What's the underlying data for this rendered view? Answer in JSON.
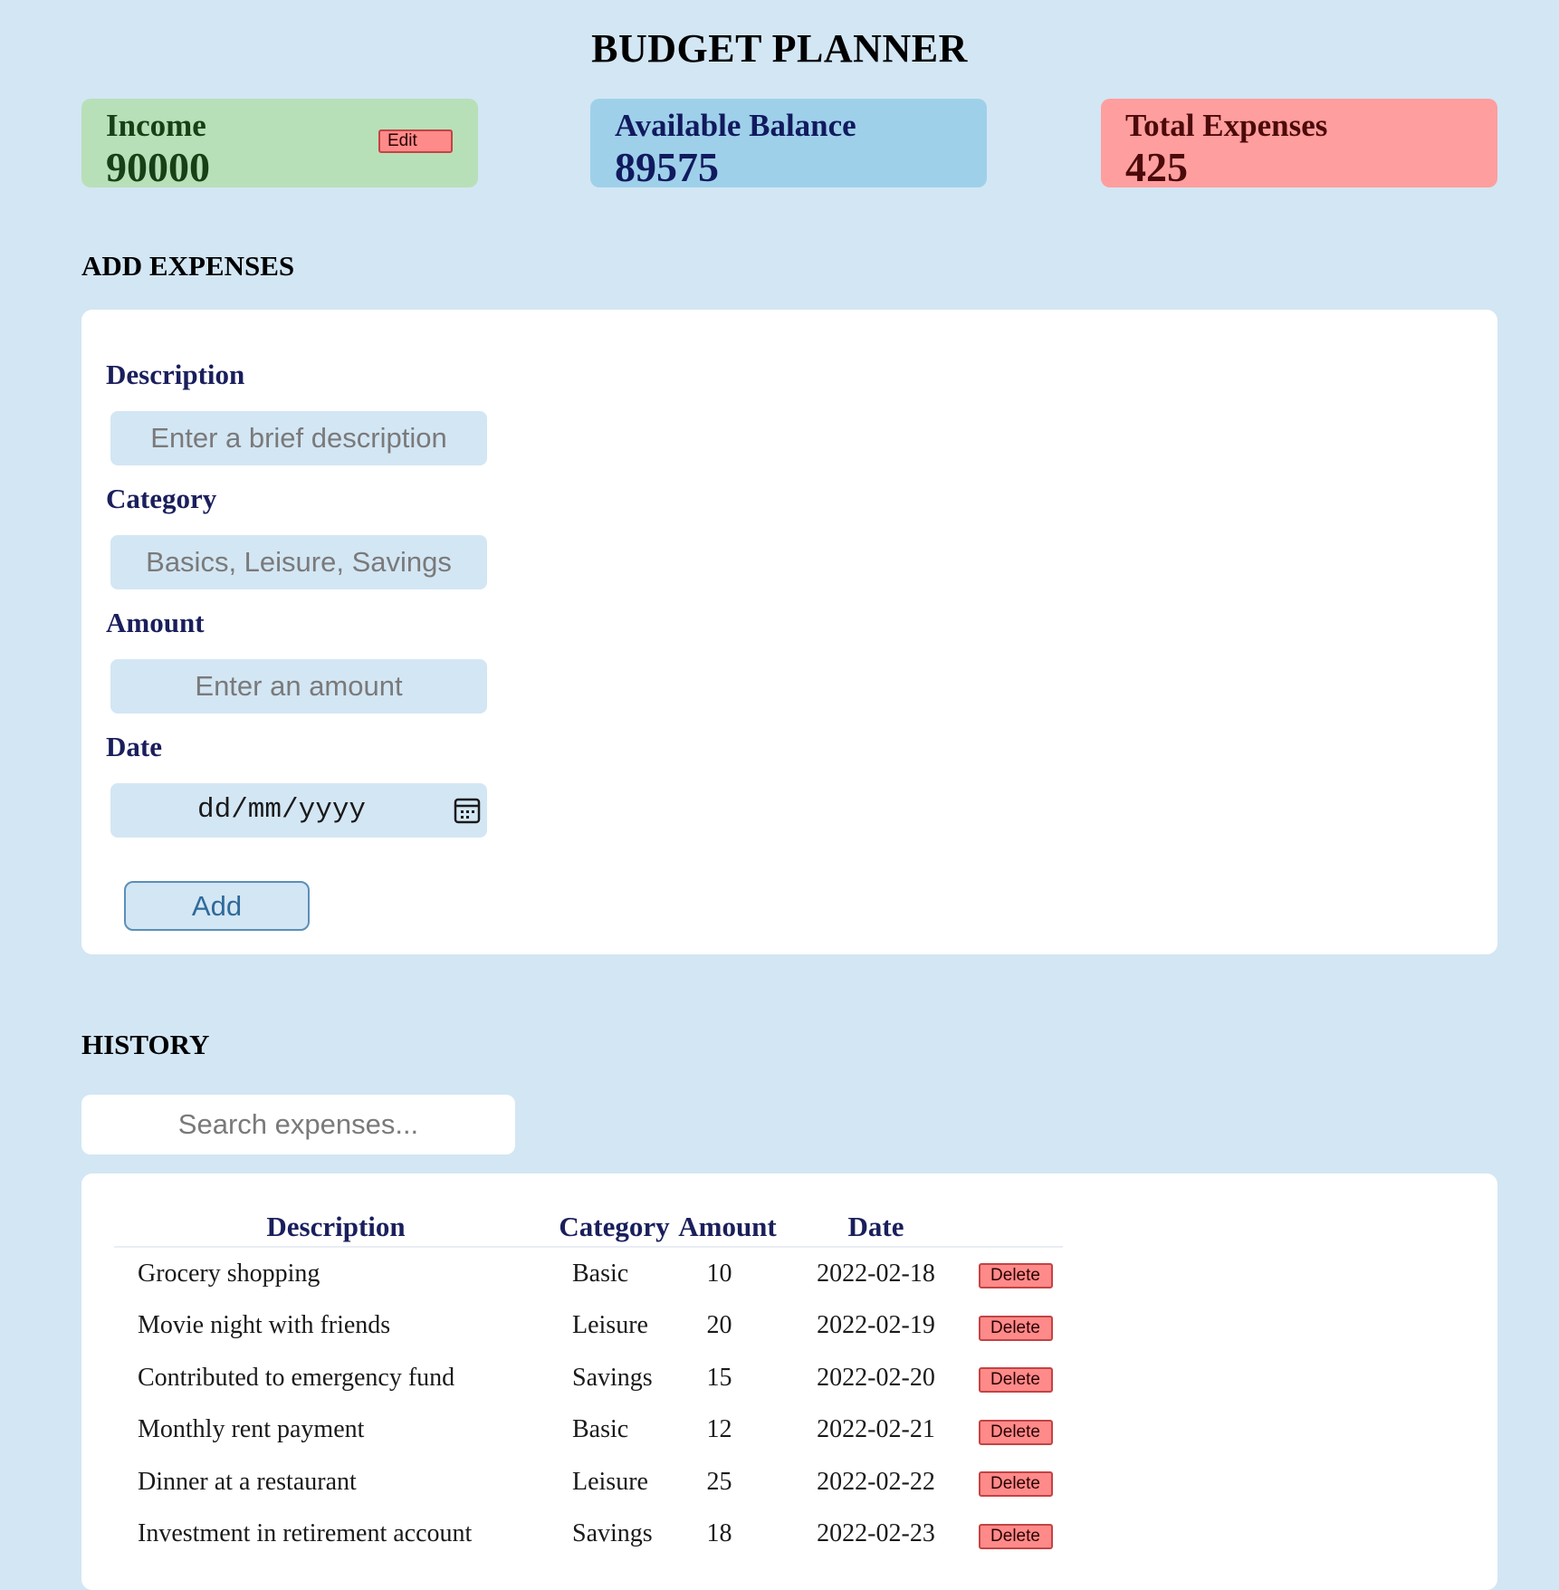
{
  "app": {
    "title": "BUDGET PLANNER"
  },
  "summary": {
    "income": {
      "label": "Income",
      "value": "90000",
      "edit_label": "Edit"
    },
    "balance": {
      "label": "Available Balance",
      "value": "89575"
    },
    "expenses": {
      "label": "Total Expenses",
      "value": "425"
    }
  },
  "add_expenses": {
    "heading": "ADD EXPENSES",
    "description": {
      "label": "Description",
      "placeholder": "Enter a brief description"
    },
    "category": {
      "label": "Category",
      "placeholder": "Basics, Leisure, Savings"
    },
    "amount": {
      "label": "Amount",
      "placeholder": "Enter an amount"
    },
    "date": {
      "label": "Date",
      "placeholder": "dd/mm/yyyy"
    },
    "add_label": "Add"
  },
  "history": {
    "heading": "HISTORY",
    "search_placeholder": "Search expenses...",
    "columns": [
      "Description",
      "Category",
      "Amount",
      "Date"
    ],
    "delete_label": "Delete",
    "rows": [
      {
        "description": "Grocery shopping",
        "category": "Basic",
        "amount": "10",
        "date": "2022-02-18"
      },
      {
        "description": "Movie night with friends",
        "category": "Leisure",
        "amount": "20",
        "date": "2022-02-19"
      },
      {
        "description": "Contributed to emergency fund",
        "category": "Savings",
        "amount": "15",
        "date": "2022-02-20"
      },
      {
        "description": "Monthly rent payment",
        "category": "Basic",
        "amount": "12",
        "date": "2022-02-21"
      },
      {
        "description": "Dinner at a restaurant",
        "category": "Leisure",
        "amount": "25",
        "date": "2022-02-22"
      },
      {
        "description": "Investment in retirement account",
        "category": "Savings",
        "amount": "18",
        "date": "2022-02-23"
      }
    ]
  },
  "icons": {
    "date_picker": "calendar-icon"
  },
  "colors": {
    "background": "#d3e6f4",
    "income": "#b8e0b8",
    "balance": "#9fd0ea",
    "expenses": "#ff9e9e",
    "delete": "#ff8a8a"
  }
}
